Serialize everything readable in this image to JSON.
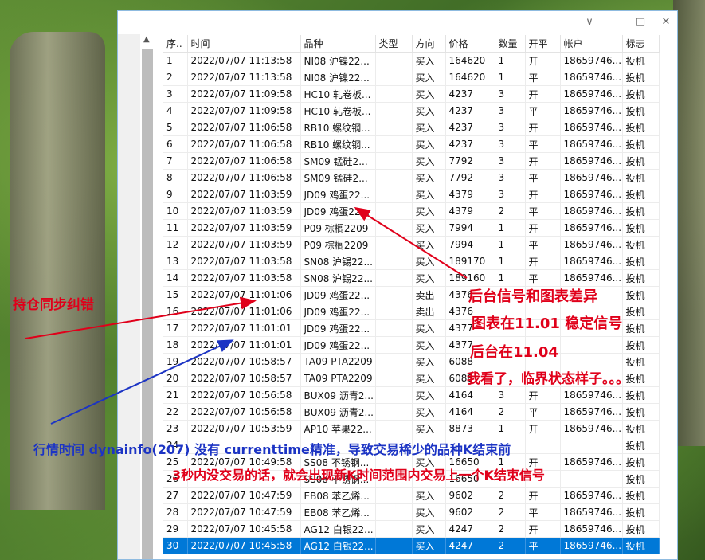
{
  "window": {
    "controls": [
      "∨",
      "—",
      "□",
      "✕"
    ]
  },
  "table": {
    "headers": [
      "序..",
      "时间",
      "品种",
      "类型",
      "方向",
      "价格",
      "数量",
      "开平",
      "帐户",
      "标志"
    ],
    "rows": [
      [
        "1",
        "2022/07/07 11:13:58",
        "NI08 沪镍22...",
        "",
        "买入",
        "164620",
        "1",
        "开",
        "18659746...",
        "投机"
      ],
      [
        "2",
        "2022/07/07 11:13:58",
        "NI08 沪镍22...",
        "",
        "买入",
        "164620",
        "1",
        "平",
        "18659746...",
        "投机"
      ],
      [
        "3",
        "2022/07/07 11:09:58",
        "HC10 轧卷板...",
        "",
        "买入",
        "4237",
        "3",
        "开",
        "18659746...",
        "投机"
      ],
      [
        "4",
        "2022/07/07 11:09:58",
        "HC10 轧卷板...",
        "",
        "买入",
        "4237",
        "3",
        "平",
        "18659746...",
        "投机"
      ],
      [
        "5",
        "2022/07/07 11:06:58",
        "RB10 螺纹钢...",
        "",
        "买入",
        "4237",
        "3",
        "开",
        "18659746...",
        "投机"
      ],
      [
        "6",
        "2022/07/07 11:06:58",
        "RB10 螺纹钢...",
        "",
        "买入",
        "4237",
        "3",
        "平",
        "18659746...",
        "投机"
      ],
      [
        "7",
        "2022/07/07 11:06:58",
        "SM09 锰硅2...",
        "",
        "买入",
        "7792",
        "3",
        "开",
        "18659746...",
        "投机"
      ],
      [
        "8",
        "2022/07/07 11:06:58",
        "SM09 锰硅2...",
        "",
        "买入",
        "7792",
        "3",
        "平",
        "18659746...",
        "投机"
      ],
      [
        "9",
        "2022/07/07 11:03:59",
        "JD09 鸡蛋22...",
        "",
        "买入",
        "4379",
        "3",
        "开",
        "18659746...",
        "投机"
      ],
      [
        "10",
        "2022/07/07 11:03:59",
        "JD09 鸡蛋22...",
        "",
        "买入",
        "4379",
        "2",
        "平",
        "18659746...",
        "投机"
      ],
      [
        "11",
        "2022/07/07 11:03:59",
        "P09 棕榈2209",
        "",
        "买入",
        "7994",
        "1",
        "开",
        "18659746...",
        "投机"
      ],
      [
        "12",
        "2022/07/07 11:03:59",
        "P09 棕榈2209",
        "",
        "买入",
        "7994",
        "1",
        "平",
        "18659746...",
        "投机"
      ],
      [
        "13",
        "2022/07/07 11:03:58",
        "SN08 沪锡22...",
        "",
        "买入",
        "189170",
        "1",
        "开",
        "18659746...",
        "投机"
      ],
      [
        "14",
        "2022/07/07 11:03:58",
        "SN08 沪锡22...",
        "",
        "买入",
        "189160",
        "1",
        "平",
        "18659746...",
        "投机"
      ],
      [
        "15",
        "2022/07/07 11:01:06",
        "JD09 鸡蛋22...",
        "",
        "卖出",
        "4376",
        "",
        "",
        "",
        "投机"
      ],
      [
        "16",
        "2022/07/07 11:01:06",
        "JD09 鸡蛋22...",
        "",
        "卖出",
        "4376",
        "",
        "",
        "",
        "投机"
      ],
      [
        "17",
        "2022/07/07 11:01:01",
        "JD09 鸡蛋22...",
        "",
        "买入",
        "4377",
        "",
        "",
        "",
        "投机"
      ],
      [
        "18",
        "2022/07/07 11:01:01",
        "JD09 鸡蛋22...",
        "",
        "买入",
        "4377",
        "",
        "",
        "",
        "投机"
      ],
      [
        "19",
        "2022/07/07 10:58:57",
        "TA09 PTA2209",
        "",
        "买入",
        "6088",
        "",
        "",
        "",
        "投机"
      ],
      [
        "20",
        "2022/07/07 10:58:57",
        "TA09 PTA2209",
        "",
        "买入",
        "6088",
        "",
        "",
        "",
        "投机"
      ],
      [
        "21",
        "2022/07/07 10:56:58",
        "BUX09 沥青2...",
        "",
        "买入",
        "4164",
        "3",
        "开",
        "18659746...",
        "投机"
      ],
      [
        "22",
        "2022/07/07 10:56:58",
        "BUX09 沥青2...",
        "",
        "买入",
        "4164",
        "2",
        "平",
        "18659746...",
        "投机"
      ],
      [
        "23",
        "2022/07/07 10:53:59",
        "AP10 苹果22...",
        "",
        "买入",
        "8873",
        "1",
        "开",
        "18659746...",
        "投机"
      ],
      [
        "24",
        "",
        "",
        "",
        "",
        "",
        "",
        "",
        "",
        "投机"
      ],
      [
        "25",
        "2022/07/07 10:49:58",
        "SS08 不锈钢...",
        "",
        "买入",
        "16650",
        "1",
        "开",
        "18659746...",
        "投机"
      ],
      [
        "26",
        "",
        "SS08 不锈钢...",
        "",
        "",
        "16650",
        "",
        "",
        "",
        "投机"
      ],
      [
        "27",
        "2022/07/07 10:47:59",
        "EB08 苯乙烯...",
        "",
        "买入",
        "9602",
        "2",
        "开",
        "18659746...",
        "投机"
      ],
      [
        "28",
        "2022/07/07 10:47:59",
        "EB08 苯乙烯...",
        "",
        "买入",
        "9602",
        "2",
        "平",
        "18659746...",
        "投机"
      ],
      [
        "29",
        "2022/07/07 10:45:58",
        "AG12 白银22...",
        "",
        "买入",
        "4247",
        "2",
        "开",
        "18659746...",
        "投机"
      ],
      [
        "30",
        "2022/07/07 10:45:58",
        "AG12 白银22...",
        "",
        "买入",
        "4247",
        "2",
        "平",
        "18659746...",
        "投机"
      ]
    ],
    "selected_row": 30
  },
  "annotations": {
    "left_red": "持仓同步纠错",
    "right_red_1": "后台信号和图表差异",
    "right_red_2": "图表在11.01 稳定信号",
    "right_red_3": "后台在11.04",
    "right_red_4": "我看了，临界状态样子。。。",
    "blue_1": "行情时间 dynainfo(207) 没有 currenttime精准，导致交易稀少的品种K结束前",
    "red_bottom": "3秒内没交易的话，就会出现新K时间范围内交易上一个K结束信号"
  },
  "colors": {
    "selection": "#0078d7",
    "annotation_red": "#e0001a",
    "annotation_blue": "#1c34c4"
  }
}
